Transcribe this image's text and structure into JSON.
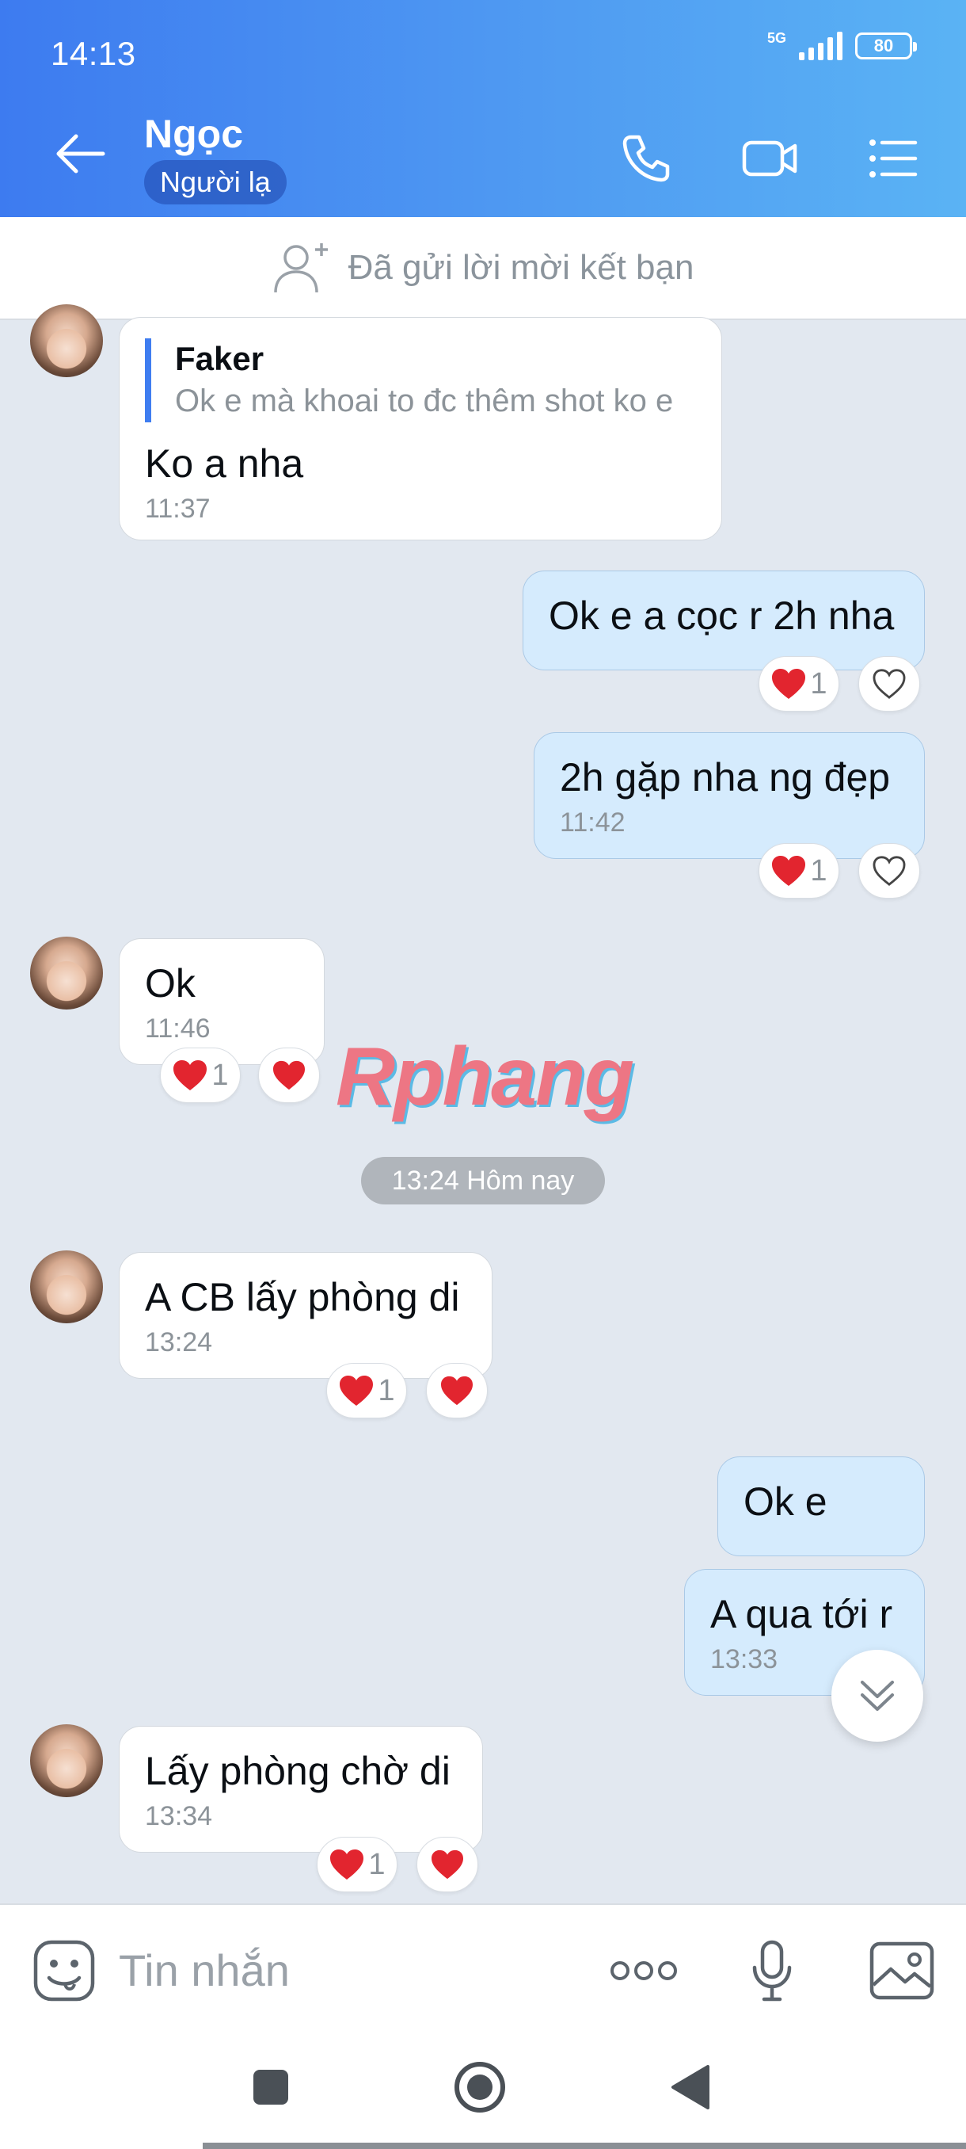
{
  "status": {
    "time": "14:13",
    "network": "5G",
    "battery": "80"
  },
  "header": {
    "name": "Ngọc",
    "badge": "Người lạ"
  },
  "friend_request": {
    "text": "Đã gửi lời mời kết bạn"
  },
  "messages": [
    {
      "side": "in",
      "quote_author": "Faker",
      "quote_text": "Ok e mà khoai to đc thêm shot ko e",
      "text": "Ko a nha",
      "time": "11:37"
    },
    {
      "side": "out",
      "text": "Ok e a cọc r 2h nha",
      "reaction_count": "1"
    },
    {
      "side": "out",
      "text": "2h gặp nha ng đẹp",
      "time": "11:42",
      "reaction_count": "1"
    },
    {
      "side": "in",
      "text": "Ok",
      "time": "11:46",
      "reaction_count": "1"
    },
    {
      "side": "in",
      "text": "A CB lấy phòng di",
      "time": "13:24",
      "reaction_count": "1"
    },
    {
      "side": "out",
      "text": "Ok e"
    },
    {
      "side": "out",
      "text": "A qua tới r",
      "time": "13:33"
    },
    {
      "side": "in",
      "text": "Lấy phòng chờ di",
      "time": "13:34",
      "reaction_count": "1"
    }
  ],
  "date_divider": "13:24 Hôm nay",
  "watermark": "Rphang",
  "input": {
    "placeholder": "Tin nhắn"
  },
  "colors": {
    "header_start": "#3d7bf0",
    "header_end": "#5ab3f4",
    "outgoing_bubble": "#d5ebfd",
    "accent": "#3f7df0",
    "heart": "#e2252f"
  },
  "icons": [
    "back-arrow-icon",
    "phone-icon",
    "video-call-icon",
    "menu-list-icon",
    "add-friend-icon",
    "sticker-icon",
    "more-icon",
    "microphone-icon",
    "image-icon",
    "heart-icon",
    "chevron-double-down-icon"
  ]
}
